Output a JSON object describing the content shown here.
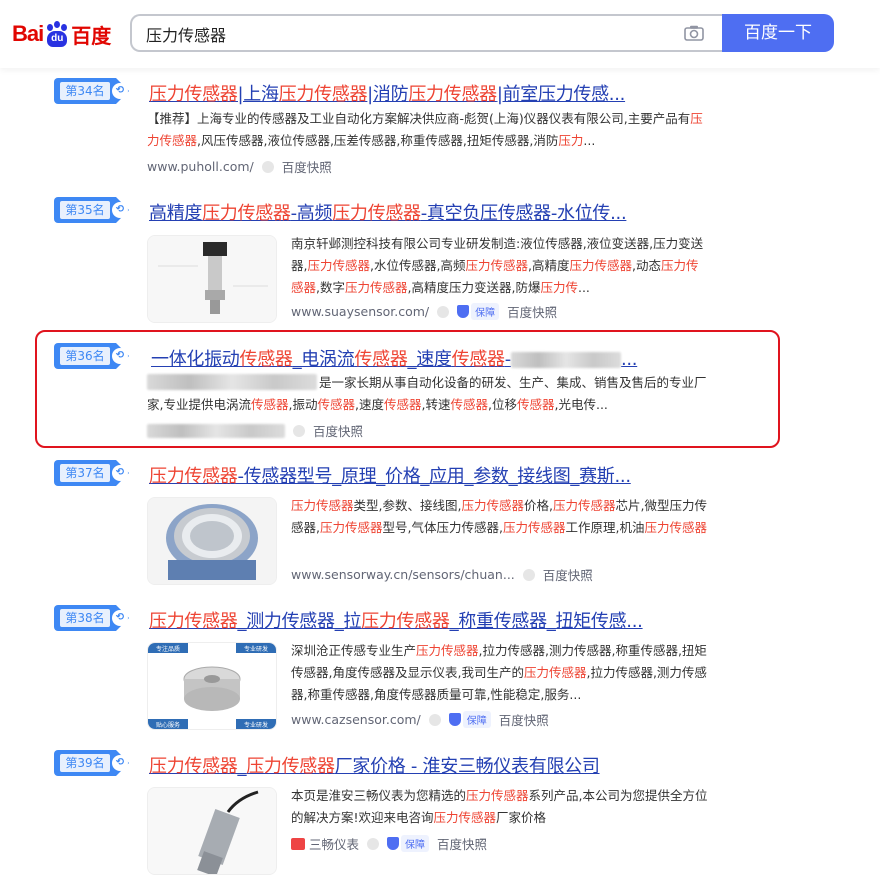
{
  "header": {
    "logo_text_bai": "Bai",
    "logo_text_du": "du",
    "logo_text_cn": "百度",
    "search_value": "压力传感器",
    "search_button": "百度一下"
  },
  "results": [
    {
      "rank": "第34名",
      "title_parts": [
        "压力传感器",
        "|上海",
        "压力传感器",
        "|消防",
        "压力传感器",
        "|前室压力传感..."
      ],
      "desc_html": "【推荐】上海专业的传感器及工业自动化方案解决供应商-彪贺(上海)仪器仪表有限公司,主要产品有<em>压力传感器</em>,风压传感器,液位传感器,压差传感器,称重传感器,扭矩传感器,消防<em>压力</em>...",
      "url": "www.puholl.com/",
      "snapshot": "百度快照"
    },
    {
      "rank": "第35名",
      "title_parts": [
        "高精度",
        "压力传感器",
        "-高频",
        "压力传感器",
        "-真空负压传感器-水位传..."
      ],
      "desc_html": "南京轩邺测控科技有限公司专业研发制造:液位传感器,液位变送器,压力变送器,<em>压力传感器</em>,水位传感器,高频<em>压力传感器</em>,高精度<em>压力传感器</em>,动态<em>压力传感器</em>,数字<em>压力传感器</em>,高精度压力变送器,防爆<em>压力传</em>...",
      "url": "www.suaysensor.com/",
      "guarantee": "保障",
      "snapshot": "百度快照"
    },
    {
      "rank": "第36名",
      "title_parts": [
        "一体化振动",
        "传感器",
        "_电涡流",
        "传感器",
        "_速度",
        "传感器",
        "-",
        "..."
      ],
      "desc_html": "是一家长期从事自动化设备的研发、生产、集成、销售及售后的专业厂家,专业提供电涡流<em>传感器</em>,振动<em>传感器</em>,速度<em>传感器</em>,转速<em>传感器</em>,位移<em>传感器</em>,光电传...",
      "snapshot": "百度快照"
    },
    {
      "rank": "第37名",
      "title_parts": [
        "压力传感器",
        "-传感器型号_原理_价格_应用_参数_接线图_赛斯..."
      ],
      "desc_html": "<em>压力传感器</em>类型,参数、接线图,<em>压力传感器</em>价格,<em>压力传感器</em>芯片,微型压力传感器,<em>压力传感器</em>型号,气体压力传感器,<em>压力传感器</em>工作原理,机油<em>压力传感器</em>",
      "url": "www.sensorway.cn/sensors/chuan...",
      "snapshot": "百度快照"
    },
    {
      "rank": "第38名",
      "title_parts": [
        "压力传感器",
        "_测力传感器_拉",
        "压力传感器",
        "_称重传感器_扭矩传感..."
      ],
      "desc_html": "深圳沧正传感专业生产<em>压力传感器</em>,拉力传感器,测力传感器,称重传感器,扭矩传感器,角度传感器及显示仪表,我司生产的<em>压力传感器</em>,拉力传感器,测力传感器,称重传感器,角度传感器质量可靠,性能稳定,服务...",
      "url": "www.cazsensor.com/",
      "guarantee": "保障",
      "snapshot": "百度快照"
    },
    {
      "rank": "第39名",
      "title_parts": [
        "压力传感器",
        "_",
        "压力传感器",
        "厂家价格 - 淮安三畅仪表有限公司"
      ],
      "desc_html": "本页是淮安三畅仪表为您精选的<em>压力传感器</em>系列产品,本公司为您提供全方位的解决方案!欢迎来电咨询<em>压力传感器</em>厂家价格",
      "url": "三畅仪表",
      "guarantee": "保障",
      "snapshot": "百度快照"
    }
  ],
  "thumb_labels": {
    "r38_top_left": "专注品质",
    "r38_top_right": "专业研发",
    "r38_bottom_left": "贴心服务",
    "r38_bottom_right": "专业研发"
  }
}
